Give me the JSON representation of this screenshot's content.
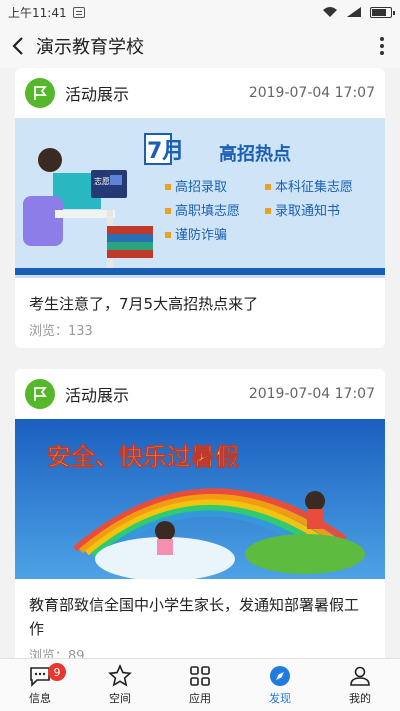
{
  "status_bar": {
    "time": "上午11:41"
  },
  "header": {
    "title": "演示教育学校"
  },
  "posts": [
    {
      "category": "活动展示",
      "date": "2019-07-04 17:07",
      "title": "考生注意了，7月5大高招热点来了",
      "views": "浏览：133",
      "banner": {
        "month": "7月",
        "headline": "高招热点",
        "desk_sign": "志愿",
        "items": [
          "高招录取",
          "本科征集志愿",
          "高职填志愿",
          "录取通知书",
          "谨防诈骗"
        ]
      }
    },
    {
      "category": "活动展示",
      "date": "2019-07-04 17:07",
      "title": "教育部致信全国中小学生家长，发通知部署暑假工作",
      "views": "浏览：89",
      "banner": {
        "headline": "安全、快乐过暑假"
      }
    }
  ],
  "bottom_nav": [
    {
      "label": "信息",
      "icon": "message-icon",
      "badge": "9"
    },
    {
      "label": "空间",
      "icon": "star-icon"
    },
    {
      "label": "应用",
      "icon": "grid-icon"
    },
    {
      "label": "发现",
      "icon": "compass-icon",
      "active": true
    },
    {
      "label": "我的",
      "icon": "person-icon"
    }
  ],
  "colors": {
    "accent": "#1f7be0",
    "category_green": "#55b82b",
    "badge_red": "#e8372c"
  }
}
